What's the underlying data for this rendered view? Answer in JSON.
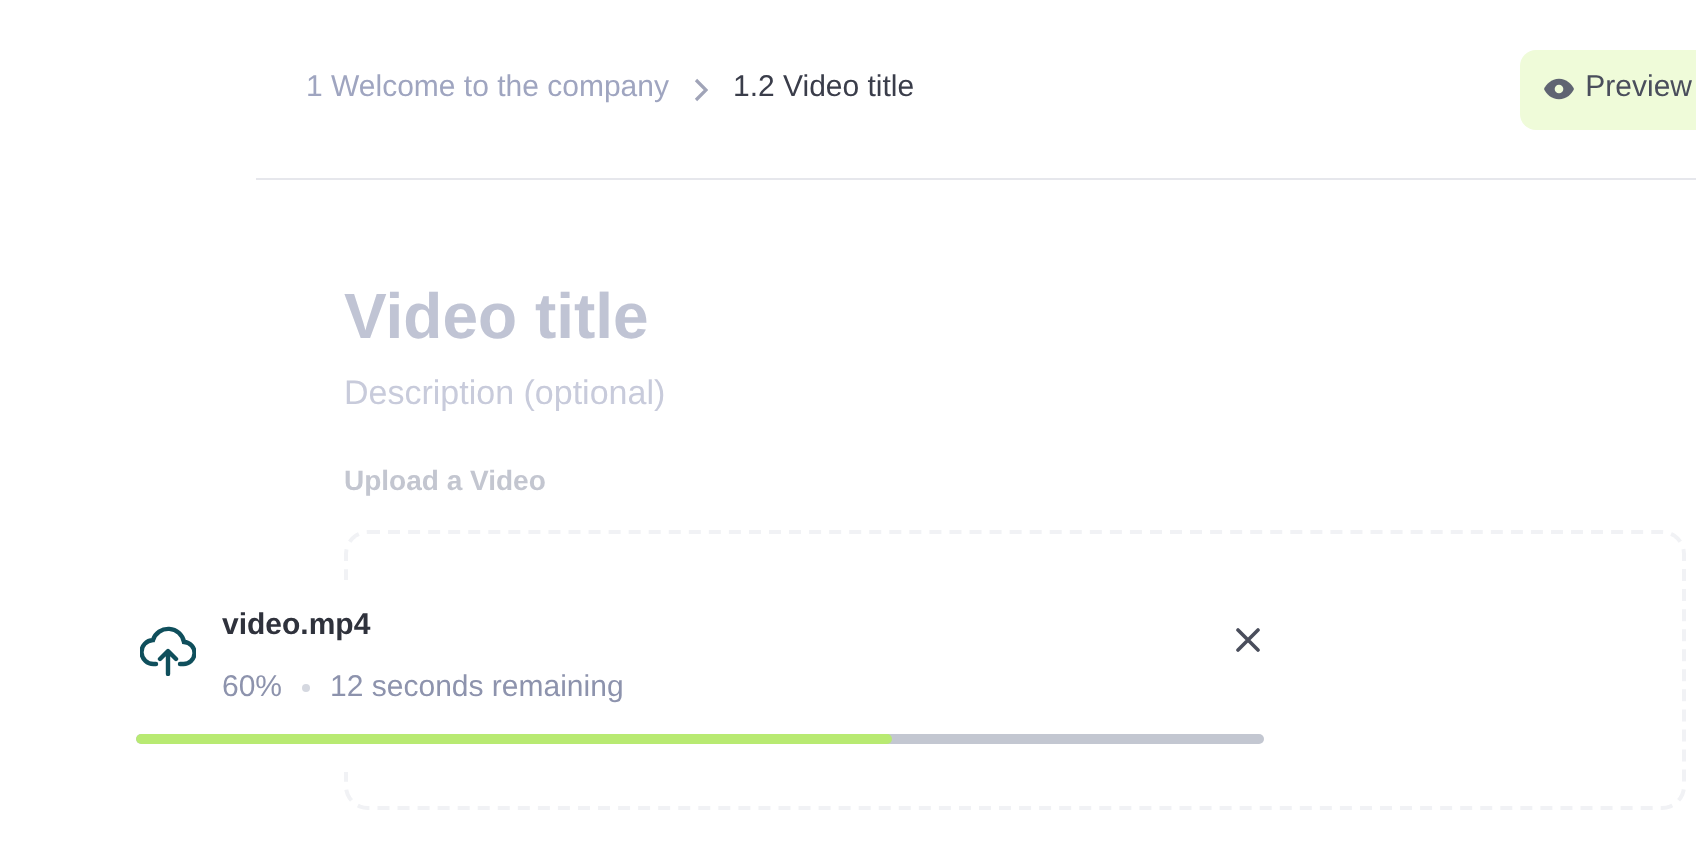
{
  "breadcrumb": [
    {
      "label": "1 Welcome to the company",
      "current": false
    },
    {
      "label": "1.2 Video title",
      "current": true
    }
  ],
  "preview_button": {
    "label": "Preview"
  },
  "editor": {
    "title": "Video title",
    "description_placeholder": "Description (optional)",
    "upload_label": "Upload a Video"
  },
  "upload_toast": {
    "file_name": "video.mp4",
    "percent": "60%",
    "remaining": "12 seconds remaining",
    "level": 0.67
  }
}
